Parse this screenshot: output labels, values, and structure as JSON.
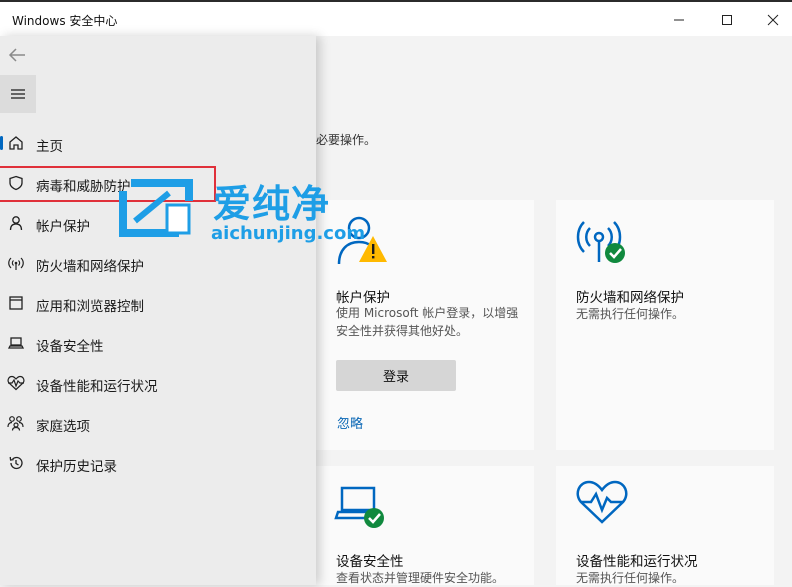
{
  "window": {
    "title": "Windows 安全中心",
    "minimize_icon": "minimize-icon",
    "maximize_icon": "maximize-icon",
    "close_icon": "close-icon"
  },
  "main": {
    "fragment_text": "必要操作。",
    "cards": [
      {
        "title": "帐户保护",
        "description": "使用 Microsoft 帐户登录，以增强安全性并获得其他好处。",
        "button_label": "登录",
        "link_label": "忽略",
        "icon": "account-warning-icon"
      },
      {
        "title": "防火墙和网络保护",
        "description": "无需执行任何操作。",
        "icon": "firewall-ok-icon"
      },
      {
        "title": "设备安全性",
        "description": "查看状态并管理硬件安全功能。",
        "icon": "laptop-ok-icon"
      },
      {
        "title": "设备性能和运行状况",
        "description": "无需执行任何操作。",
        "icon": "heart-pulse-icon"
      }
    ]
  },
  "sidebar": {
    "back_icon": "back-arrow-icon",
    "menu_icon": "hamburger-menu-icon",
    "items": [
      {
        "label": "主页",
        "icon": "home-icon",
        "selected": true
      },
      {
        "label": "病毒和威胁防护",
        "icon": "shield-icon",
        "highlighted": true
      },
      {
        "label": "帐户保护",
        "icon": "person-icon"
      },
      {
        "label": "防火墙和网络保护",
        "icon": "wireless-antenna-icon"
      },
      {
        "label": "应用和浏览器控制",
        "icon": "app-window-icon"
      },
      {
        "label": "设备安全性",
        "icon": "laptop-icon"
      },
      {
        "label": "设备性能和运行状况",
        "icon": "heart-pulse-icon"
      },
      {
        "label": "家庭选项",
        "icon": "family-icon"
      },
      {
        "label": "保护历史记录",
        "icon": "history-icon"
      }
    ]
  },
  "watermark": {
    "chinese": "爱纯净",
    "url": "aichunjing.com"
  },
  "colors": {
    "accent": "#0067c0",
    "ok_green": "#10893e",
    "warning_yellow": "#ffb900",
    "highlight_red": "#e0303a",
    "watermark_blue": "#1e9ee6"
  }
}
